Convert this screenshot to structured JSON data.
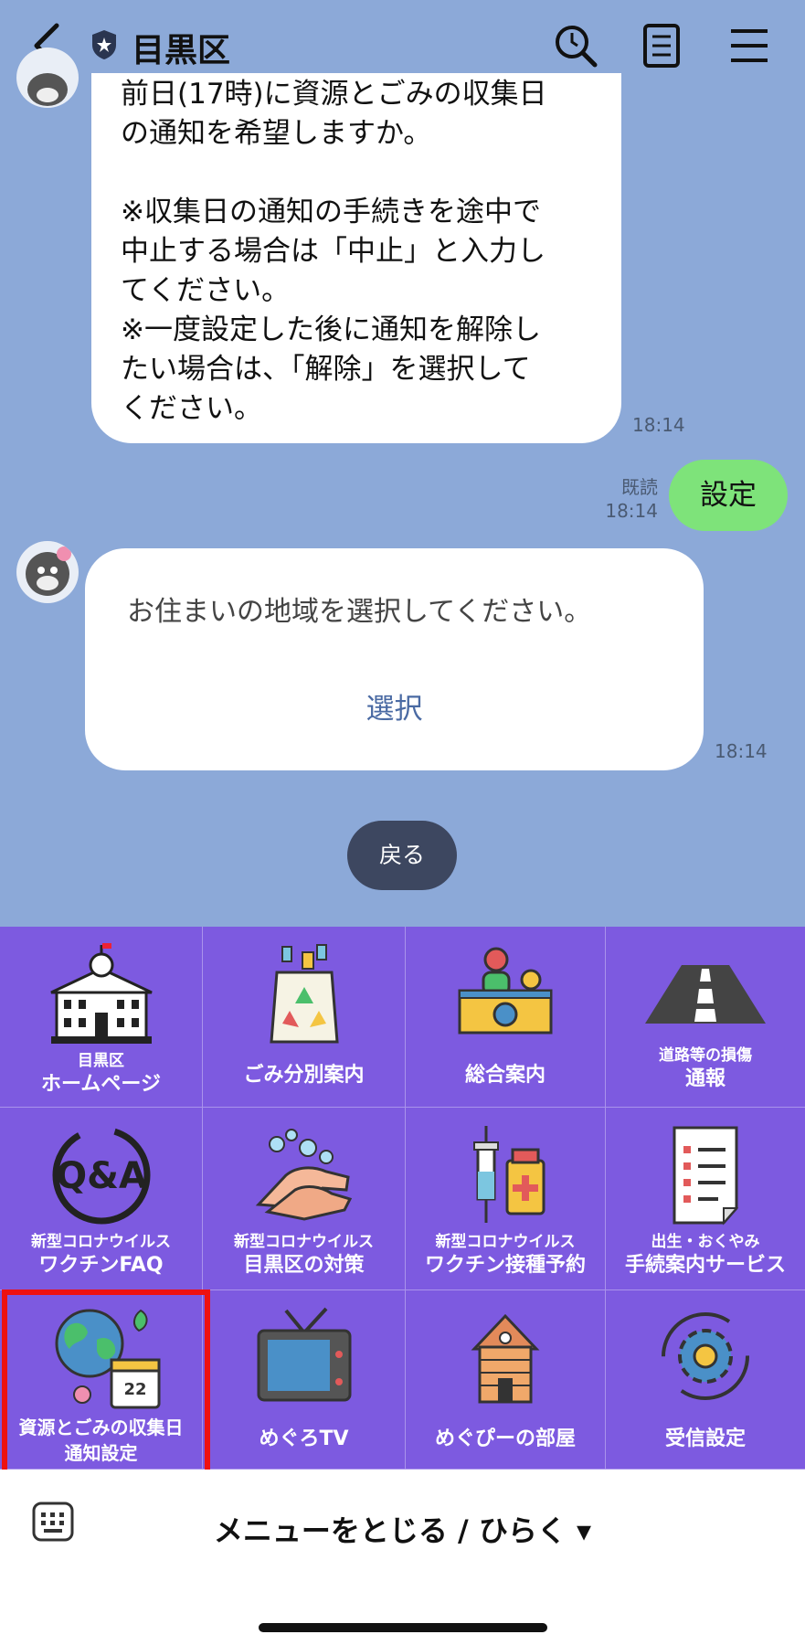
{
  "header": {
    "title": "目黒区",
    "icons": [
      "back-icon",
      "shield-icon",
      "search-icon",
      "notes-icon",
      "menu-icon"
    ]
  },
  "chat": {
    "message1": {
      "text": "前日(17時)に資源とごみの収集日\nの通知を希望しますか。\n\n※収集日の通知の手続きを途中で\n中止する場合は「中止」と入力し\nてください。\n※一度設定した後に通知を解除し\nたい場合は、「解除」を選択して\nください。",
      "time": "18:14"
    },
    "sent": {
      "text": "設定",
      "read_label": "既読",
      "time": "18:14"
    },
    "message2": {
      "text": "お住まいの地域を選択してください。",
      "button": "選択",
      "time": "18:14"
    },
    "back_button": "戻る"
  },
  "rich_menu": {
    "items": [
      {
        "small": "目黒区",
        "large": "ホームページ",
        "icon": "city-hall-icon"
      },
      {
        "small": "",
        "large": "ごみ分別案内",
        "icon": "recycle-bag-icon"
      },
      {
        "small": "",
        "large": "総合案内",
        "icon": "reception-desk-icon"
      },
      {
        "small": "道路等の損傷",
        "large": "通報",
        "icon": "road-icon"
      },
      {
        "small": "新型コロナウイルス",
        "large": "ワクチンFAQ",
        "icon": "qa-icon"
      },
      {
        "small": "新型コロナウイルス",
        "large": "目黒区の対策",
        "icon": "hand-washing-icon"
      },
      {
        "small": "新型コロナウイルス",
        "large": "ワクチン接種予約",
        "icon": "vaccine-icon"
      },
      {
        "small": "出生・おくやみ",
        "large": "手続案内サービス",
        "icon": "document-list-icon"
      },
      {
        "small": "資源とごみの収集日",
        "large": "通知設定",
        "icon": "globe-calendar-icon",
        "calendar_day": "22"
      },
      {
        "small": "",
        "large": "めぐろTV",
        "icon": "tv-icon"
      },
      {
        "small": "",
        "large": "めぐぴーの部屋",
        "icon": "house-icon"
      },
      {
        "small": "",
        "large": "受信設定",
        "icon": "gear-icon"
      }
    ]
  },
  "footer": {
    "toggle_label": "メニューをとじる / ひらく ▾",
    "icon": "keyboard-icon"
  },
  "colors": {
    "background": "#8ca9d8",
    "menu": "#7d5ae0",
    "sent_bubble": "#7ee37a",
    "highlight": "#ee1111"
  }
}
